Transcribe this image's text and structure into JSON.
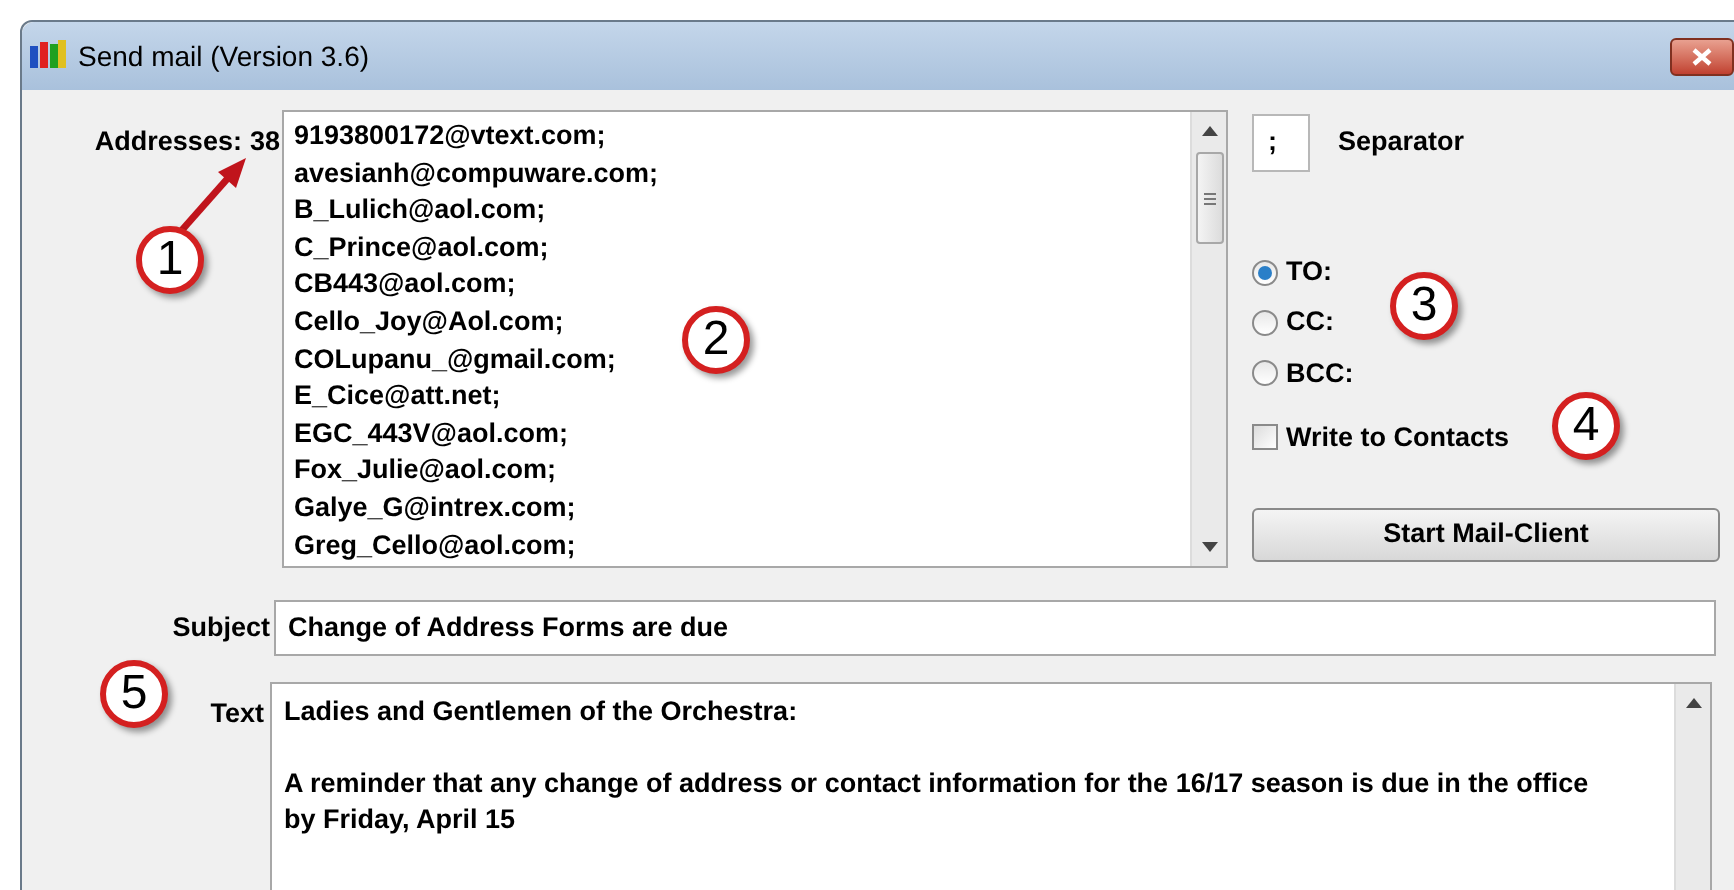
{
  "window": {
    "title": "Send mail (Version 3.6)"
  },
  "addresses": {
    "label": "Addresses:",
    "count": "38",
    "items": [
      "9193800172@vtext.com;",
      "avesianh@compuware.com;",
      "B_Lulich@aol.com;",
      "C_Prince@aol.com;",
      "CB443@aol.com;",
      "Cello_Joy@Aol.com;",
      "COLupanu_@gmail.com;",
      "E_Cice@att.net;",
      "EGC_443V@aol.com;",
      "Fox_Julie@aol.com;",
      "Galye_G@intrex.com;",
      "Greg_Cello@aol.com;"
    ]
  },
  "separator": {
    "value": ";",
    "label": "Separator"
  },
  "recipient_types": [
    {
      "label": "TO:",
      "selected": true
    },
    {
      "label": "CC:",
      "selected": false
    },
    {
      "label": "BCC:",
      "selected": false
    }
  ],
  "write_to_contacts": {
    "label": "Write to Contacts",
    "checked": false
  },
  "start_button": "Start Mail-Client",
  "subject": {
    "label": "Subject",
    "value": "Change of Address Forms are due"
  },
  "text": {
    "label": "Text",
    "paragraphs": [
      "Ladies and Gentlemen of the Orchestra:",
      "A reminder that any change of address or contact information for the 16/17 season is due in the office by Friday, April 15"
    ]
  },
  "callouts": [
    "1",
    "2",
    "3",
    "4",
    "5"
  ]
}
